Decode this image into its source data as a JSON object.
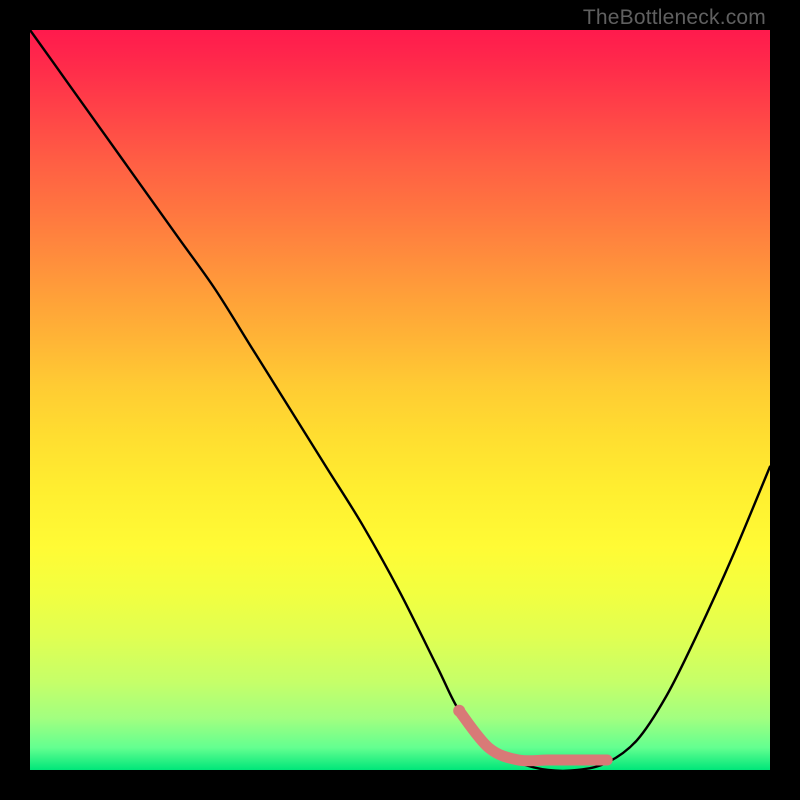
{
  "attribution": "TheBottleneck.com",
  "colors": {
    "gradient_top": "#ff1a4d",
    "gradient_bottom": "#00e67a",
    "curve": "#000000",
    "bottom_highlight": "#d87a77",
    "frame": "#000000"
  },
  "chart_data": {
    "type": "line",
    "title": "",
    "xlabel": "",
    "ylabel": "",
    "xlim": [
      0,
      1
    ],
    "ylim": [
      0,
      1
    ],
    "x": [
      0.0,
      0.05,
      0.1,
      0.15,
      0.2,
      0.25,
      0.3,
      0.35,
      0.4,
      0.45,
      0.5,
      0.55,
      0.58,
      0.62,
      0.66,
      0.7,
      0.74,
      0.78,
      0.82,
      0.86,
      0.9,
      0.95,
      1.0
    ],
    "values": [
      1.0,
      0.93,
      0.86,
      0.79,
      0.72,
      0.65,
      0.57,
      0.49,
      0.41,
      0.33,
      0.24,
      0.14,
      0.08,
      0.03,
      0.01,
      0.0,
      0.0,
      0.01,
      0.04,
      0.1,
      0.18,
      0.29,
      0.41
    ],
    "highlight_segment_x": [
      0.58,
      0.8
    ],
    "annotations": []
  }
}
